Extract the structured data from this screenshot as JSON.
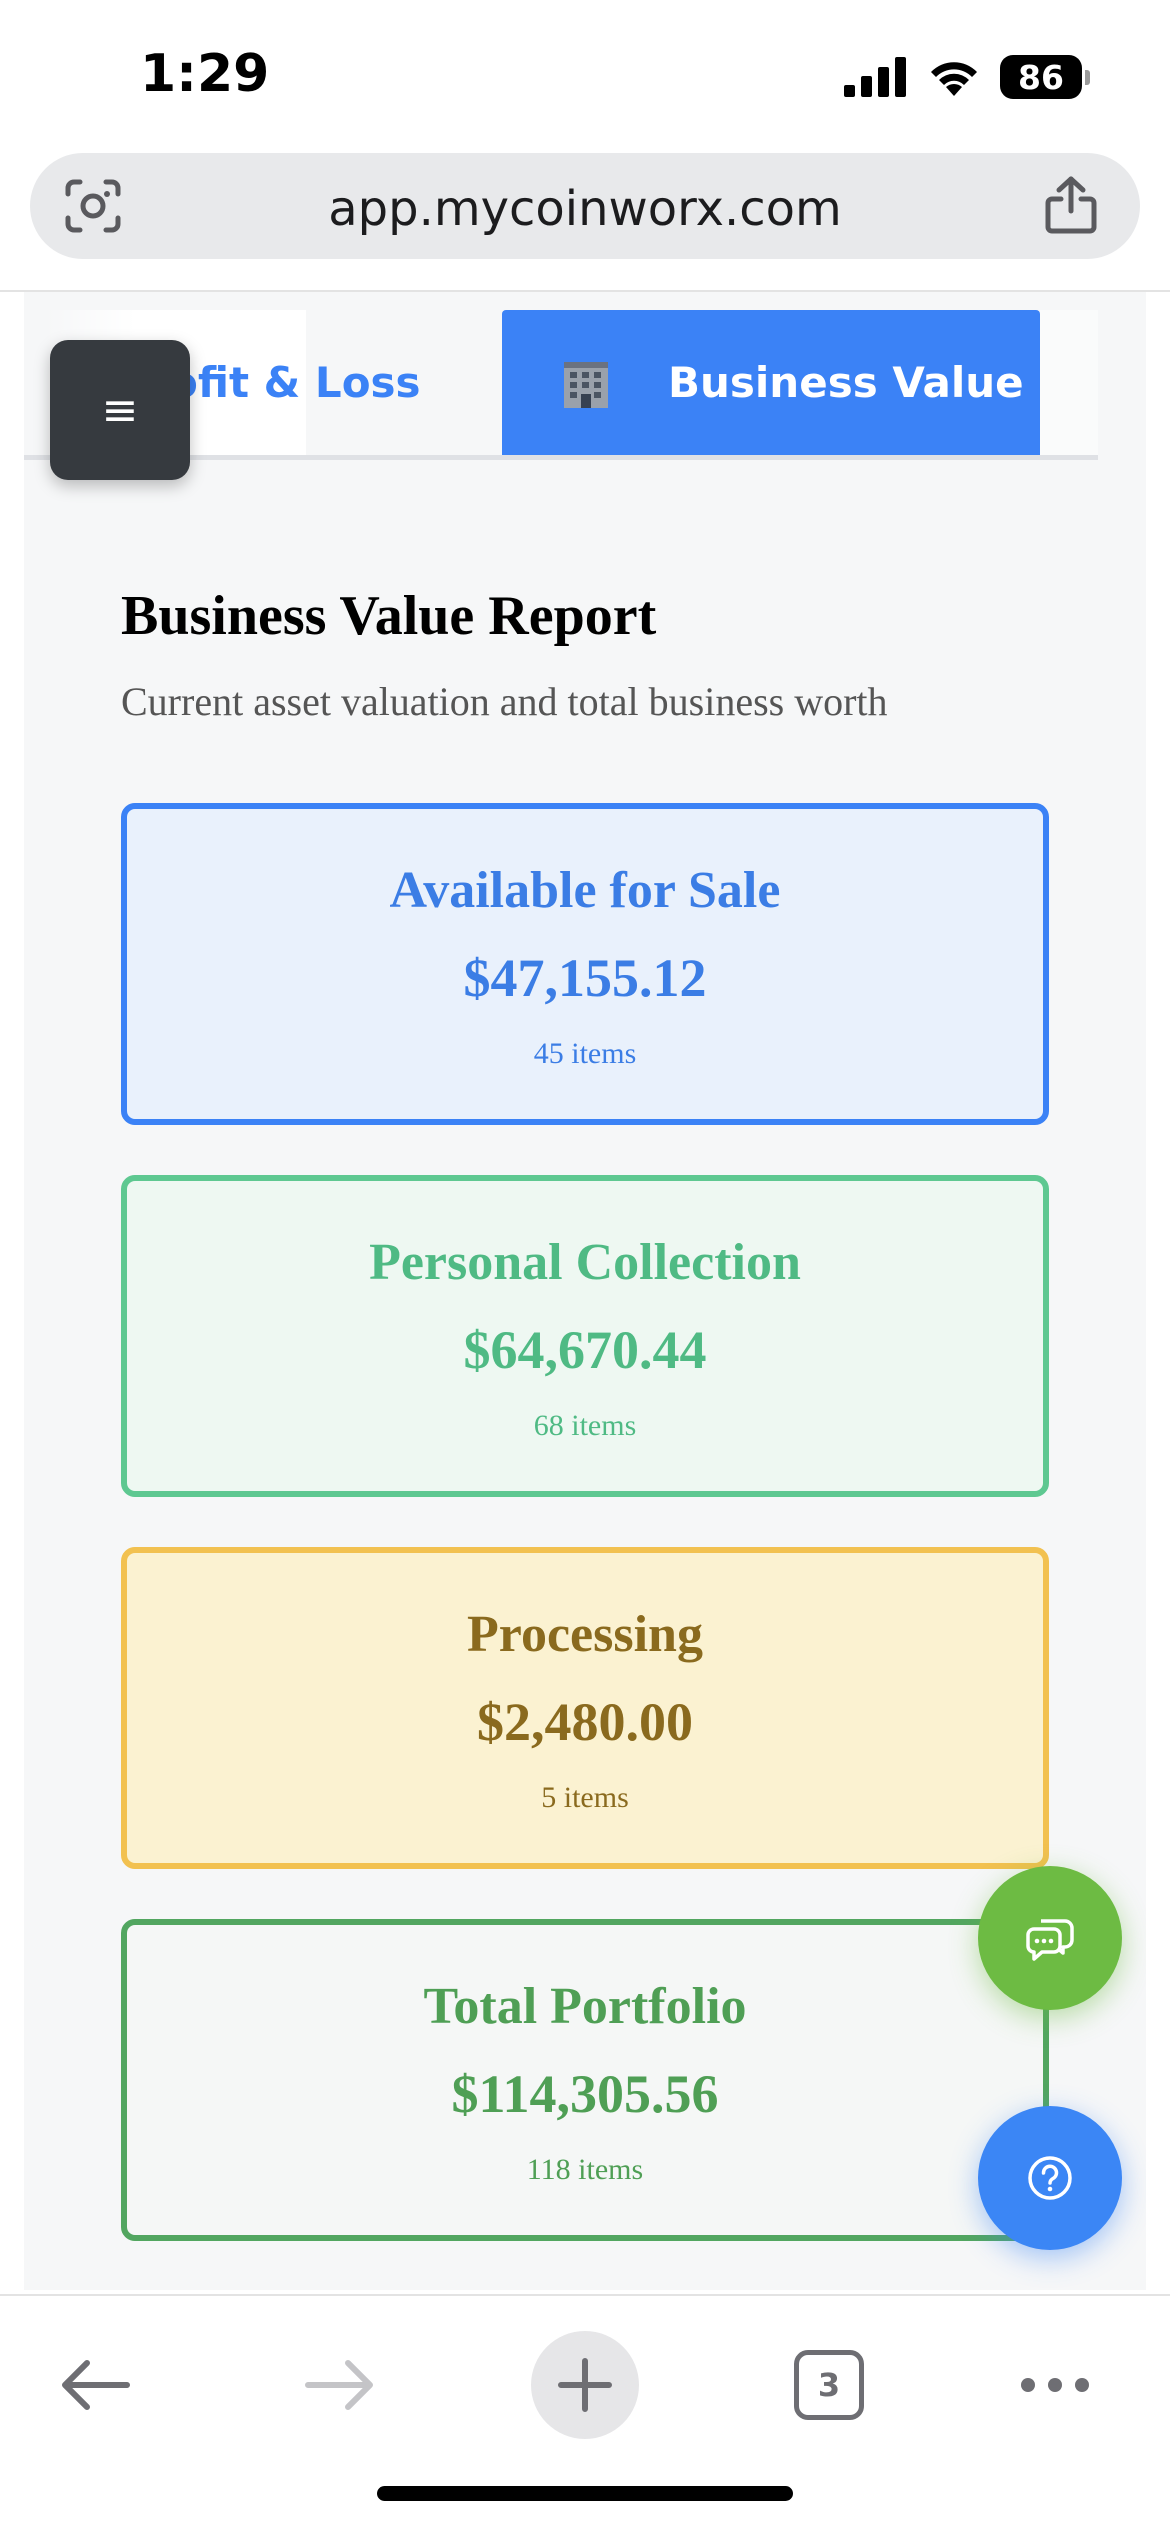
{
  "status_bar": {
    "time": "1:29",
    "battery": "86",
    "icons": [
      "signal-icon",
      "wifi-icon",
      "battery-icon"
    ]
  },
  "browser": {
    "url": "app.mycoinworx.com",
    "tab_count": "3",
    "icons": [
      "visual-search-icon",
      "share-icon",
      "back-icon",
      "forward-icon",
      "plus-icon",
      "tabs-icon",
      "more-icon"
    ]
  },
  "app": {
    "menu_glyph": "≡",
    "tabs": [
      {
        "label": "Profit & Loss",
        "visible_label": "ofit & Loss",
        "active": false
      },
      {
        "label": "Business Value",
        "icon": "building-icon",
        "active": true
      }
    ]
  },
  "report": {
    "title": "Business Value Report",
    "subtitle": "Current asset valuation and total business worth",
    "cards": [
      {
        "title": "Available for Sale",
        "amount": "$47,155.12",
        "count": "45 items",
        "color": "#3b82f6"
      },
      {
        "title": "Personal Collection",
        "amount": "$64,670.44",
        "count": "68 items",
        "color": "#5ec891"
      },
      {
        "title": "Processing",
        "amount": "$2,480.00",
        "count": "5 items",
        "color": "#f2c150"
      },
      {
        "title": "Total Portfolio",
        "amount": "$114,305.56",
        "count": "118 items",
        "color": "#52a660"
      }
    ]
  },
  "fabs": [
    {
      "icon": "chat-icon",
      "color": "#6dbb43"
    },
    {
      "icon": "help-icon",
      "color": "#3b86f5"
    }
  ]
}
